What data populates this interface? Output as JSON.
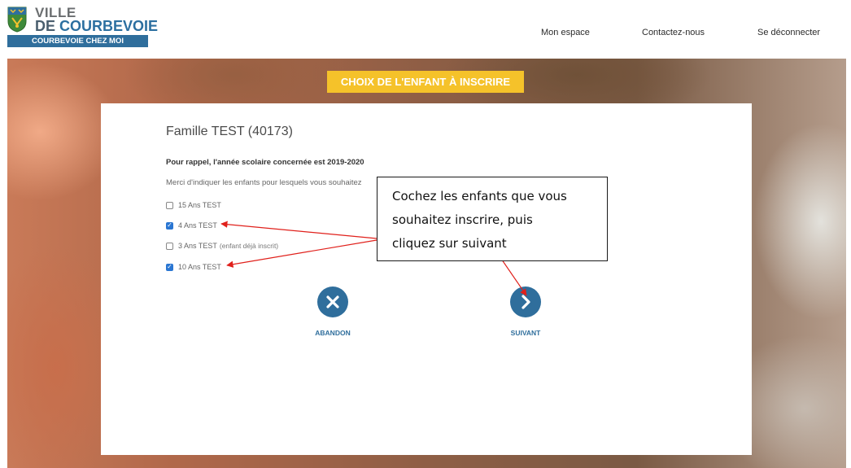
{
  "header": {
    "logo": {
      "line1": "VILLE",
      "line2_prefix": "DE",
      "line2_name": "COURBEVOIE",
      "banner": "COURBEVOIE CHEZ MOI"
    },
    "nav": [
      {
        "label": "Mon espace"
      },
      {
        "label": "Contactez-nous"
      },
      {
        "label": "Se déconnecter"
      }
    ]
  },
  "step_title": "CHOIX DE L'ENFANT À INSCRIRE",
  "form": {
    "family_title": "Famille TEST (40173)",
    "reminder": "Pour rappel, l'année scolaire concernée est 2019-2020",
    "instruction": "Merci d'indiquer les enfants pour lesquels vous souhaitez",
    "children": [
      {
        "label": "15 Ans TEST",
        "note": "",
        "checked": false
      },
      {
        "label": "4 Ans TEST",
        "note": "",
        "checked": true
      },
      {
        "label": "3 Ans TEST",
        "note": "(enfant déjà inscrit)",
        "checked": false
      },
      {
        "label": "10 Ans TEST",
        "note": "",
        "checked": true
      }
    ]
  },
  "actions": {
    "abandon_label": "ABANDON",
    "next_label": "SUIVANT"
  },
  "callout": {
    "line1": "Cochez les enfants que vous",
    "line2": "souhaitez inscrire, puis",
    "line3": "cliquez sur suivant"
  },
  "colors": {
    "brand_blue": "#2f6e9c",
    "step_yellow": "#f5c22a",
    "annotation_red": "#e0201b",
    "checkbox_blue": "#2a76d2"
  },
  "icons": {
    "abandon": "close-icon",
    "next": "chevron-right-icon",
    "logo": "city-crest-icon"
  }
}
